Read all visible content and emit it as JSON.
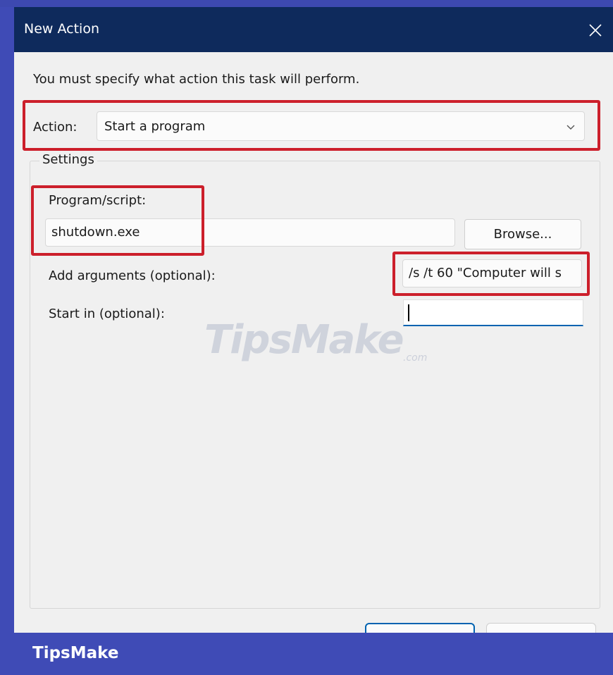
{
  "window": {
    "title": "New Action"
  },
  "instruction": "You must specify what action this task will perform.",
  "action": {
    "label": "Action:",
    "selected": "Start a program"
  },
  "settings": {
    "legend": "Settings",
    "program_label": "Program/script:",
    "program_value": "shutdown.exe",
    "browse_label": "Browse...",
    "arguments_label": "Add arguments (optional):",
    "arguments_value": "/s /t 60 \"Computer will s",
    "startin_label": "Start in (optional):",
    "startin_value": ""
  },
  "watermark": {
    "main": "TipsMake",
    "suffix": ".com"
  },
  "footer": {
    "brand": "TipsMake"
  },
  "icons": {
    "close": "close-icon",
    "dropdown": "chevron-down-icon"
  },
  "colors": {
    "titlebar": "#0e2a5c",
    "highlight": "#cc1f2b",
    "footer": "#3f4bb6",
    "focus": "#0063b1"
  }
}
